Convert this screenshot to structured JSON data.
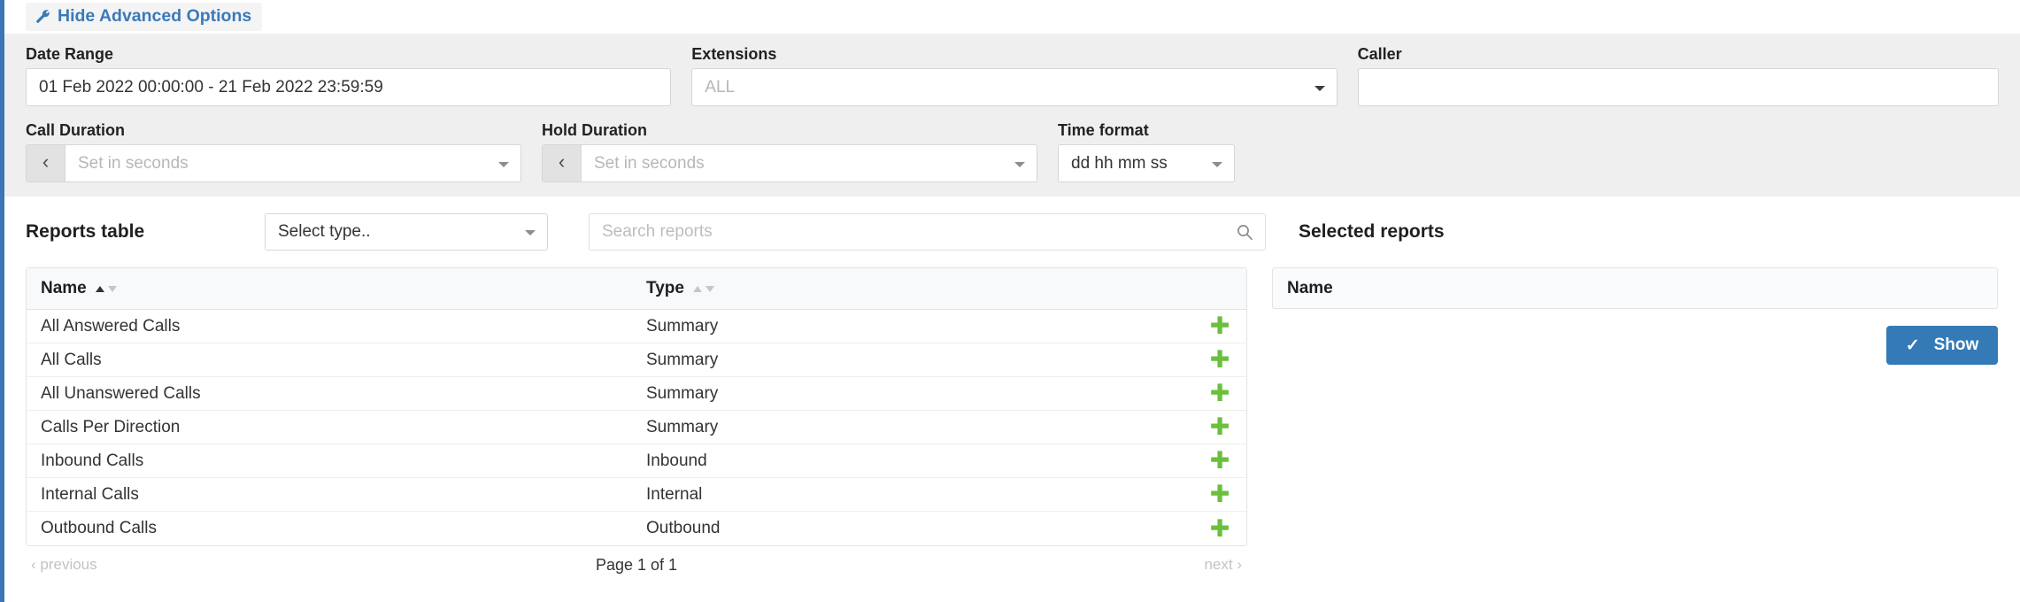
{
  "theme": {
    "accent_blue": "#337ab7",
    "link_blue": "#3a7ab8",
    "plus_green": "#6abf3d",
    "panel_gray": "#efefef",
    "sidebar_edge": "#3a76b8"
  },
  "advanced_toggle": {
    "label": "Hide Advanced Options",
    "icon": "wrench-icon"
  },
  "filters": {
    "date_range": {
      "label": "Date Range",
      "value": "01 Feb 2022 00:00:00 - 21 Feb 2022 23:59:59"
    },
    "extensions": {
      "label": "Extensions",
      "placeholder": "ALL",
      "value": ""
    },
    "caller": {
      "label": "Caller",
      "placeholder": "",
      "value": ""
    },
    "call_duration": {
      "label": "Call Duration",
      "operator": "‹",
      "placeholder": "Set in seconds",
      "value": ""
    },
    "hold_duration": {
      "label": "Hold Duration",
      "operator": "‹",
      "placeholder": "Set in seconds",
      "value": ""
    },
    "time_format": {
      "label": "Time format",
      "value": "dd hh mm ss"
    }
  },
  "reports": {
    "title": "Reports table",
    "type_filter": {
      "value": "Select type.."
    },
    "search": {
      "placeholder": "Search reports",
      "value": ""
    },
    "columns": {
      "name": "Name",
      "type": "Type"
    },
    "sort": {
      "column": "Name",
      "direction": "asc"
    },
    "rows": [
      {
        "name": "All Answered Calls",
        "type": "Summary",
        "action": "add"
      },
      {
        "name": "All Calls",
        "type": "Summary",
        "action": "add"
      },
      {
        "name": "All Unanswered Calls",
        "type": "Summary",
        "action": "add"
      },
      {
        "name": "Calls Per Direction",
        "type": "Summary",
        "action": "add"
      },
      {
        "name": "Inbound Calls",
        "type": "Inbound",
        "action": "add"
      },
      {
        "name": "Internal Calls",
        "type": "Internal",
        "action": "add"
      },
      {
        "name": "Outbound Calls",
        "type": "Outbound",
        "action": "add"
      }
    ],
    "pagination": {
      "previous": "‹ previous",
      "page_label": "Page 1 of 1",
      "next": "next ›",
      "current_page": 1,
      "total_pages": 1
    }
  },
  "selected_reports": {
    "title": "Selected reports",
    "column_name": "Name",
    "rows": [],
    "show_button": {
      "label": "Show",
      "icon": "check-icon"
    }
  }
}
